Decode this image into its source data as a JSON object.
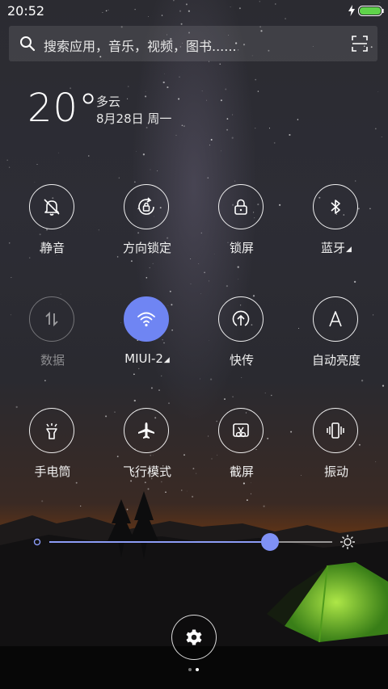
{
  "status_bar": {
    "time": "20:52",
    "battery_color": "#5fd34a",
    "icons": [
      "charging-icon",
      "battery-icon"
    ]
  },
  "search": {
    "placeholder": "搜索应用，音乐，视频，图书......",
    "icons": [
      "search-icon",
      "scan-icon"
    ]
  },
  "weather": {
    "temperature": "20°",
    "condition": "多云",
    "date": "8月28日 周一"
  },
  "toggles": [
    {
      "label": "静音",
      "icon": "bell-off-icon",
      "state": "off"
    },
    {
      "label": "方向锁定",
      "icon": "rotation-lock-icon",
      "state": "off"
    },
    {
      "label": "锁屏",
      "icon": "lock-icon",
      "state": "off"
    },
    {
      "label": "蓝牙",
      "icon": "bluetooth-icon",
      "state": "off",
      "more_indicator": "◢"
    },
    {
      "label": "数据",
      "icon": "mobile-data-icon",
      "state": "disabled"
    },
    {
      "label": "MIUI-2",
      "icon": "wifi-icon",
      "state": "on",
      "more_indicator": "◢"
    },
    {
      "label": "快传",
      "icon": "transfer-icon",
      "state": "off"
    },
    {
      "label": "自动亮度",
      "icon": "auto-brightness-icon",
      "state": "off"
    },
    {
      "label": "手电筒",
      "icon": "flashlight-icon",
      "state": "off"
    },
    {
      "label": "飞行模式",
      "icon": "airplane-icon",
      "state": "off"
    },
    {
      "label": "截屏",
      "icon": "screenshot-icon",
      "state": "off"
    },
    {
      "label": "振动",
      "icon": "vibrate-icon",
      "state": "off"
    }
  ],
  "brightness": {
    "level": 0.78,
    "accent": "#7f91f5",
    "icons": [
      "brightness-low-icon",
      "brightness-high-icon"
    ]
  },
  "settings": {
    "icon": "gear-icon"
  },
  "pager": {
    "pages": 2,
    "current": 2
  }
}
